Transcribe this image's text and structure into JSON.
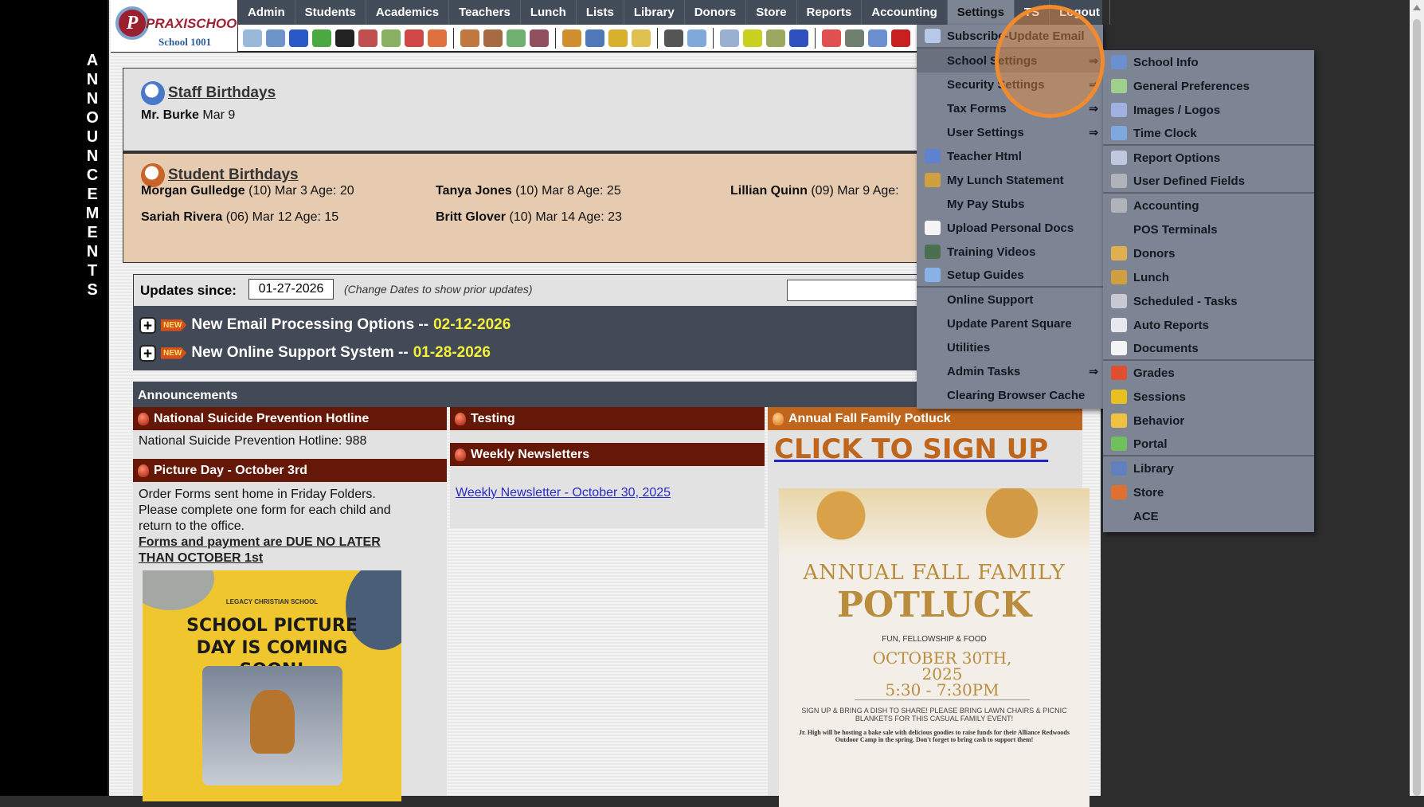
{
  "side_label": [
    "A",
    "N",
    "N",
    "O",
    "U",
    "N",
    "C",
    "E",
    "M",
    "E",
    "N",
    "T",
    "S"
  ],
  "logo": {
    "initial": "P",
    "brand": "PRAXISCHOOL",
    "school": "School 1001"
  },
  "nav": {
    "items": [
      "Admin",
      "Students",
      "Academics",
      "Teachers",
      "Lunch",
      "Lists",
      "Library",
      "Donors",
      "Store",
      "Reports",
      "Accounting",
      "Settings",
      "TS",
      "Logout"
    ],
    "active": "Settings"
  },
  "toolbar_icons": [
    {
      "name": "search-icon",
      "color": "#9ab8d8"
    },
    {
      "name": "calendar-grid-icon",
      "color": "#6e94c8"
    },
    {
      "name": "email-at-icon",
      "color": "#2a58c8"
    },
    {
      "name": "chat-icon",
      "color": "#4ca840"
    },
    {
      "name": "phone-icon",
      "color": "#222222"
    },
    {
      "name": "speaker-icon",
      "color": "#c05050"
    },
    {
      "name": "schedule-icon",
      "color": "#88b060"
    },
    {
      "name": "calendar-icon",
      "color": "#d04848"
    },
    {
      "name": "megaphone-icon",
      "color": "#e07040"
    },
    {
      "sep": true
    },
    {
      "name": "add-student-icon",
      "color": "#c07840"
    },
    {
      "name": "student-icon",
      "color": "#a86a40"
    },
    {
      "name": "money-icon",
      "color": "#70b070"
    },
    {
      "name": "parents-icon",
      "color": "#905060"
    },
    {
      "sep": true
    },
    {
      "name": "lunch-icon",
      "color": "#d09030"
    },
    {
      "name": "library-book-icon",
      "color": "#5078b8"
    },
    {
      "name": "bell-icon",
      "color": "#d8b030"
    },
    {
      "name": "export-icon",
      "color": "#e0c050"
    },
    {
      "sep": true
    },
    {
      "name": "teacher-icon",
      "color": "#555555"
    },
    {
      "name": "alarm-clock-icon",
      "color": "#80a8d8"
    },
    {
      "sep": true
    },
    {
      "name": "spreadsheet-icon",
      "color": "#9ab0d0"
    },
    {
      "name": "check-icon",
      "color": "#c8d020"
    },
    {
      "name": "print-check-icon",
      "color": "#9aa860"
    },
    {
      "name": "accounts-payable-icon",
      "color": "#3050c0"
    },
    {
      "sep": true
    },
    {
      "name": "pdf-icon",
      "color": "#e05050"
    },
    {
      "name": "cash-register-icon",
      "color": "#708070"
    },
    {
      "name": "help-icon",
      "color": "#6a90d0"
    },
    {
      "name": "power-icon",
      "color": "#c82020"
    }
  ],
  "staff_birthdays": {
    "title": "Staff Birthdays",
    "entries": [
      {
        "name": "Mr. Burke",
        "info": "Mar 9"
      }
    ]
  },
  "student_birthdays": {
    "title": "Student Birthdays",
    "entries": [
      {
        "name": "Morgan Gulledge",
        "info": "(10) Mar 3 Age: 20"
      },
      {
        "name": "Tanya Jones",
        "info": "(10) Mar 8 Age: 25"
      },
      {
        "name": "Lillian Quinn",
        "info": "(09) Mar 9 Age:"
      },
      {
        "name": "Sariah Rivera",
        "info": "(06) Mar 12 Age: 15"
      },
      {
        "name": "Britt Glover",
        "info": "(10) Mar 14 Age: 23"
      }
    ]
  },
  "updates": {
    "label": "Updates since:",
    "date": "01-27-2026",
    "hint": "(Change Dates to show prior updates)",
    "new_badge": "NEW",
    "items": [
      {
        "title": "New Email Processing Options --",
        "date": "02-12-2026"
      },
      {
        "title": "New Online Support System --",
        "date": "01-28-2026"
      }
    ]
  },
  "announcements": {
    "header": "Announcements",
    "col1": [
      {
        "title": "National Suicide Prevention Hotline",
        "body": "National Suicide Prevention Hotline: 988"
      },
      {
        "title": "Picture Day - October 3rd",
        "body": "Order Forms sent home in Friday Folders. Please complete one form for each child and return to the office.",
        "emphasis": "Forms and payment are DUE NO LATER THAN OCTOBER 1st",
        "poster": {
          "org": "LEGACY CHRISTIAN SCHOOL",
          "headline": "SCHOOL PICTURE DAY IS COMING SOON!"
        }
      }
    ],
    "col2": [
      {
        "title": "Testing"
      },
      {
        "title": "Weekly Newsletters",
        "link": "Weekly Newsletter - October 30, 2025"
      }
    ],
    "col3": {
      "title": "Annual Fall Family Potluck",
      "signup": "CLICK TO SIGN UP",
      "flyer": {
        "line1": "ANNUAL FALL FAMILY",
        "line2": "POTLUCK",
        "tagline": "FUN, FELLOWSHIP & FOOD",
        "date": "OCTOBER 30TH, 2025",
        "time": "5:30 - 7:30PM",
        "note": "SIGN UP & BRING A DISH TO SHARE! PLEASE BRING LAWN CHAIRS & PICNIC BLANKETS FOR THIS CASUAL FAMILY EVENT!",
        "bake_sale": "Jr. High will be hosting a bake sale with delicious goodies to raise funds for their Alliance Redwoods Outdoor Camp in the spring. Don't forget to bring cash to support them!"
      }
    }
  },
  "settings_menu": [
    {
      "label": "Subscribe-Update Email",
      "icon": "envelope-icon",
      "color": "#b8c8e8",
      "sep": true
    },
    {
      "label": "School Settings",
      "arrow": "⇒",
      "highlight": true
    },
    {
      "label": "Security Settings",
      "arrow": "⇒"
    },
    {
      "label": "Tax Forms",
      "arrow": "⇒"
    },
    {
      "label": "User Settings",
      "arrow": "⇒"
    },
    {
      "label": "Teacher Html",
      "icon": "html-icon",
      "color": "#6080d0"
    },
    {
      "label": "My Lunch Statement",
      "icon": "burger-icon",
      "color": "#d0a040"
    },
    {
      "label": "My Pay Stubs"
    },
    {
      "label": "Upload Personal Docs",
      "icon": "document-icon",
      "color": "#f4f4f4"
    },
    {
      "label": "Training Videos",
      "icon": "film-icon",
      "color": "#4a7050"
    },
    {
      "label": "Setup Guides",
      "icon": "help-icon",
      "color": "#8ab0e8",
      "sep": true
    },
    {
      "label": "Online Support"
    },
    {
      "label": "Update Parent Square"
    },
    {
      "label": "Utilities"
    },
    {
      "label": "Admin Tasks",
      "arrow": "⇒"
    },
    {
      "label": "Clearing Browser Cache"
    }
  ],
  "school_settings_submenu": [
    {
      "label": "School Info",
      "icon": "person-icon",
      "color": "#6a90d0"
    },
    {
      "label": "General Preferences",
      "icon": "preferences-icon",
      "color": "#a0d090"
    },
    {
      "label": "Images / Logos",
      "icon": "images-icon",
      "color": "#a0b0e0"
    },
    {
      "label": "Time Clock",
      "icon": "alarm-clock-icon",
      "color": "#80a8e0",
      "sep": true
    },
    {
      "label": "Report Options",
      "icon": "printer-icon",
      "color": "#c0c8e0"
    },
    {
      "label": "User Defined Fields",
      "icon": "gear-icon",
      "color": "#b0b4ba",
      "sep": true
    },
    {
      "label": "Accounting",
      "icon": "gear-icon",
      "color": "#b0b4ba"
    },
    {
      "label": "POS Terminals"
    },
    {
      "label": "Donors",
      "icon": "donor-icon",
      "color": "#e0b050"
    },
    {
      "label": "Lunch",
      "icon": "burger-icon",
      "color": "#d0a040"
    },
    {
      "label": "Scheduled - Tasks",
      "icon": "columns-icon",
      "color": "#c8c8d0"
    },
    {
      "label": "Auto Reports",
      "icon": "notebook-icon",
      "color": "#e8e8f0"
    },
    {
      "label": "Documents",
      "icon": "document-icon",
      "color": "#f4f4f4",
      "sep": true
    },
    {
      "label": "Grades",
      "icon": "grade-a-plus-icon",
      "color": "#e05030"
    },
    {
      "label": "Sessions",
      "icon": "group-icon",
      "color": "#e8c020"
    },
    {
      "label": "Behavior",
      "icon": "star-medal-icon",
      "color": "#f0c040"
    },
    {
      "label": "Portal",
      "icon": "globe-icon",
      "color": "#70c060",
      "sep": true
    },
    {
      "label": "Library",
      "icon": "book-icon",
      "color": "#6080c0"
    },
    {
      "label": "Store",
      "icon": "store-icon",
      "color": "#e07030"
    },
    {
      "label": "ACE"
    }
  ]
}
